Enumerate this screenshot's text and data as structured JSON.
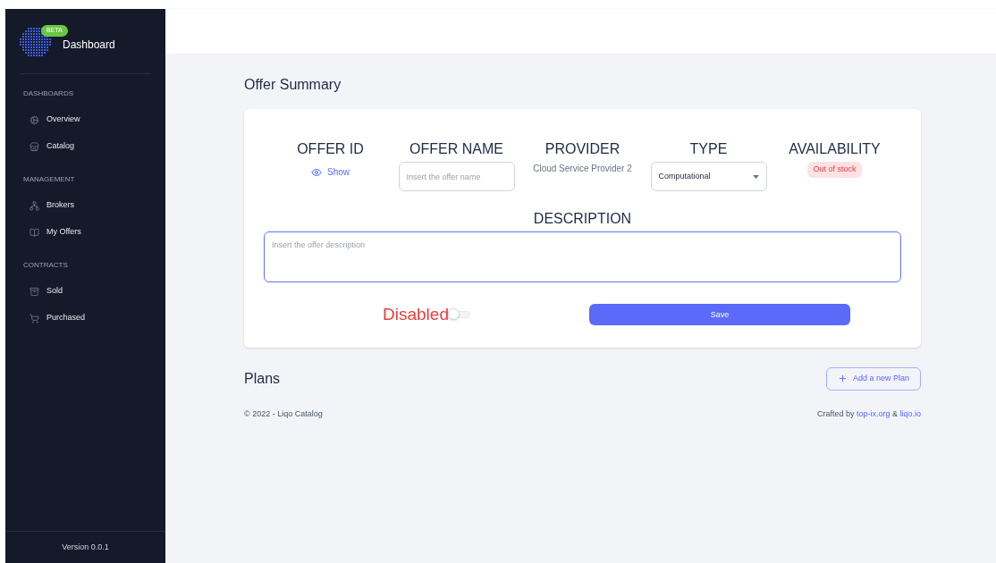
{
  "brand": {
    "badge": "BETA",
    "title": "Dashboard"
  },
  "sidebar": {
    "sections": [
      {
        "heading": "DASHBOARDS",
        "items": [
          {
            "label": "Overview"
          },
          {
            "label": "Catalog"
          }
        ]
      },
      {
        "heading": "MANAGEMENT",
        "items": [
          {
            "label": "Brokers"
          },
          {
            "label": "My Offers"
          }
        ]
      },
      {
        "heading": "CONTRACTS",
        "items": [
          {
            "label": "Sold"
          },
          {
            "label": "Purchased"
          }
        ]
      }
    ],
    "version": "Version 0.0.1"
  },
  "page_title": "Offer Summary",
  "offer": {
    "fields": [
      {
        "kind": "reveal",
        "label": "OFFER ID",
        "value": "Show"
      },
      {
        "kind": "input",
        "label": "OFFER NAME",
        "placeholder": "Insert the offer name"
      },
      {
        "kind": "text",
        "label": "PROVIDER",
        "value": "Cloud Service Provider 2"
      },
      {
        "kind": "select",
        "label": "TYPE",
        "value": "Computational"
      },
      {
        "kind": "badge",
        "label": "AVAILABILITY",
        "value": "Out of stock"
      }
    ],
    "description": {
      "label": "DESCRIPTION",
      "placeholder": "Insert the offer description"
    },
    "toggle": {
      "label": "Disabled",
      "on": false
    },
    "save": "Save"
  },
  "plans": {
    "title": "Plans",
    "add_button": "Add a new Plan"
  },
  "footer": {
    "copyright": "© 2022 - Liqo Catalog",
    "credit": {
      "prefix": "Crafted by",
      "links": [
        "top-ix.org",
        "liqo.io"
      ],
      "joiner": "&"
    }
  }
}
